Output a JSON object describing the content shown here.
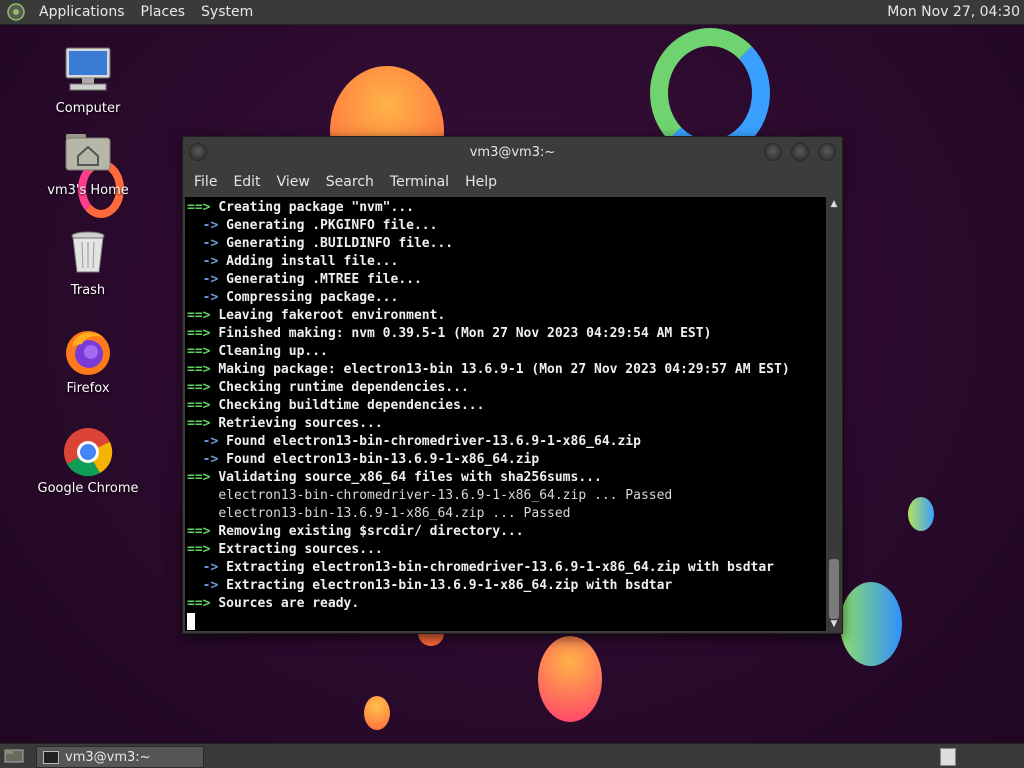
{
  "top_panel": {
    "menus": [
      "Applications",
      "Places",
      "System"
    ],
    "clock": "Mon Nov 27, 04:30"
  },
  "desktop": {
    "icons": [
      {
        "label": "Computer",
        "icon": "computer-icon"
      },
      {
        "label": "vm3's Home",
        "icon": "home-folder-icon"
      },
      {
        "label": "Trash",
        "icon": "trash-icon"
      },
      {
        "label": "Firefox",
        "icon": "firefox-icon"
      },
      {
        "label": "Google Chrome",
        "icon": "chrome-icon"
      }
    ]
  },
  "window": {
    "title": "vm3@vm3:~",
    "menu": [
      "File",
      "Edit",
      "View",
      "Search",
      "Terminal",
      "Help"
    ]
  },
  "terminal": {
    "lines": [
      {
        "prefix": "==> ",
        "text": "Creating package \"nvm\"...",
        "kind": "g"
      },
      {
        "prefix": "  -> ",
        "text": "Generating .PKGINFO file...",
        "kind": "b"
      },
      {
        "prefix": "  -> ",
        "text": "Generating .BUILDINFO file...",
        "kind": "b"
      },
      {
        "prefix": "  -> ",
        "text": "Adding install file...",
        "kind": "b"
      },
      {
        "prefix": "  -> ",
        "text": "Generating .MTREE file...",
        "kind": "b"
      },
      {
        "prefix": "  -> ",
        "text": "Compressing package...",
        "kind": "b"
      },
      {
        "prefix": "==> ",
        "text": "Leaving fakeroot environment.",
        "kind": "g"
      },
      {
        "prefix": "==> ",
        "text": "Finished making: nvm 0.39.5-1 (Mon 27 Nov 2023 04:29:54 AM EST)",
        "kind": "g"
      },
      {
        "prefix": "==> ",
        "text": "Cleaning up...",
        "kind": "g"
      },
      {
        "prefix": "==> ",
        "text": "Making package: electron13-bin 13.6.9-1 (Mon 27 Nov 2023 04:29:57 AM EST)",
        "kind": "g"
      },
      {
        "prefix": "==> ",
        "text": "Checking runtime dependencies...",
        "kind": "g"
      },
      {
        "prefix": "==> ",
        "text": "Checking buildtime dependencies...",
        "kind": "g"
      },
      {
        "prefix": "==> ",
        "text": "Retrieving sources...",
        "kind": "g"
      },
      {
        "prefix": "  -> ",
        "text": "Found electron13-bin-chromedriver-13.6.9-1-x86_64.zip",
        "kind": "b"
      },
      {
        "prefix": "  -> ",
        "text": "Found electron13-bin-13.6.9-1-x86_64.zip",
        "kind": "b"
      },
      {
        "prefix": "==> ",
        "text": "Validating source_x86_64 files with sha256sums...",
        "kind": "g"
      },
      {
        "prefix": "    ",
        "text": "electron13-bin-chromedriver-13.6.9-1-x86_64.zip ... Passed",
        "kind": "p"
      },
      {
        "prefix": "    ",
        "text": "electron13-bin-13.6.9-1-x86_64.zip ... Passed",
        "kind": "p"
      },
      {
        "prefix": "==> ",
        "text": "Removing existing $srcdir/ directory...",
        "kind": "g"
      },
      {
        "prefix": "==> ",
        "text": "Extracting sources...",
        "kind": "g"
      },
      {
        "prefix": "  -> ",
        "text": "Extracting electron13-bin-chromedriver-13.6.9-1-x86_64.zip with bsdtar",
        "kind": "b"
      },
      {
        "prefix": "  -> ",
        "text": "Extracting electron13-bin-13.6.9-1-x86_64.zip with bsdtar",
        "kind": "b"
      },
      {
        "prefix": "==> ",
        "text": "Sources are ready.",
        "kind": "g"
      }
    ]
  },
  "taskbar": {
    "task_label": "vm3@vm3:~"
  }
}
